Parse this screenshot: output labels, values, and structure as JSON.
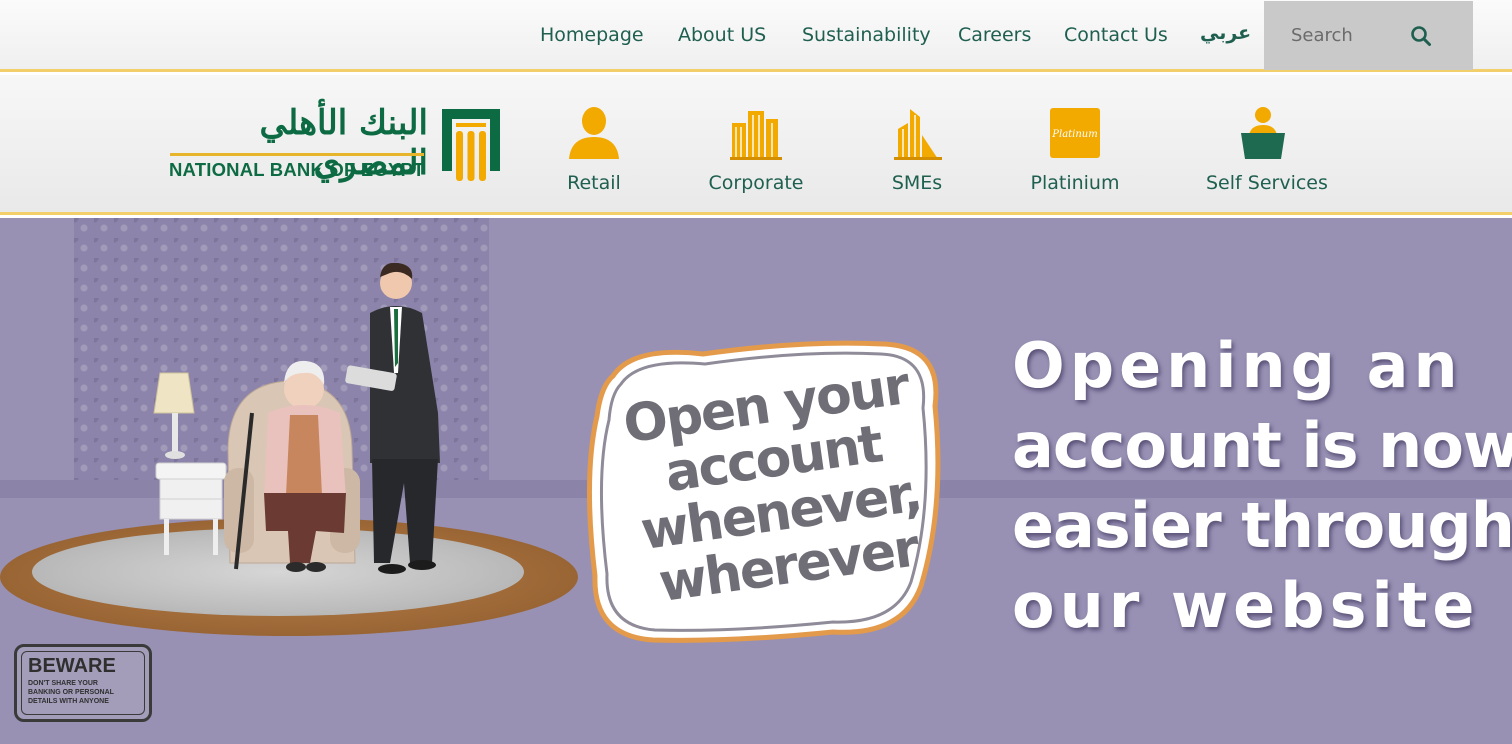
{
  "top_nav": {
    "items": [
      "Homepage",
      "About US",
      "Sustainability",
      "Careers",
      "Contact Us"
    ],
    "language_link": "عربي",
    "search": {
      "placeholder": "Search",
      "icon": "search-icon"
    }
  },
  "brand": {
    "name_ar": "البنك الأهلي المصري",
    "name_en": "NATIONAL BANK OF EGYPT",
    "colors": {
      "green": "#0d6b43",
      "gold": "#f2a900",
      "accent_line": "#f2cf6a"
    }
  },
  "categories": [
    {
      "label": "Retail",
      "icon": "person-icon"
    },
    {
      "label": "Corporate",
      "icon": "buildings-icon"
    },
    {
      "label": "SMEs",
      "icon": "small-building-icon"
    },
    {
      "label": "Platinium",
      "icon": "platinum-card-icon",
      "icon_text": "Platinum"
    },
    {
      "label": "Self Services",
      "icon": "person-laptop-icon"
    }
  ],
  "hero": {
    "bubble_lines": [
      "Open your",
      "account",
      "whenever,",
      "wherever"
    ],
    "headline_lines": [
      "Opening an",
      "account is now",
      "easier through",
      "our website"
    ],
    "beware": {
      "title": "BEWARE",
      "lines": [
        "DON'T SHARE YOUR",
        "BANKING OR PERSONAL",
        "DETAILS WITH ANYONE"
      ]
    },
    "background_color": "#9891b4"
  }
}
